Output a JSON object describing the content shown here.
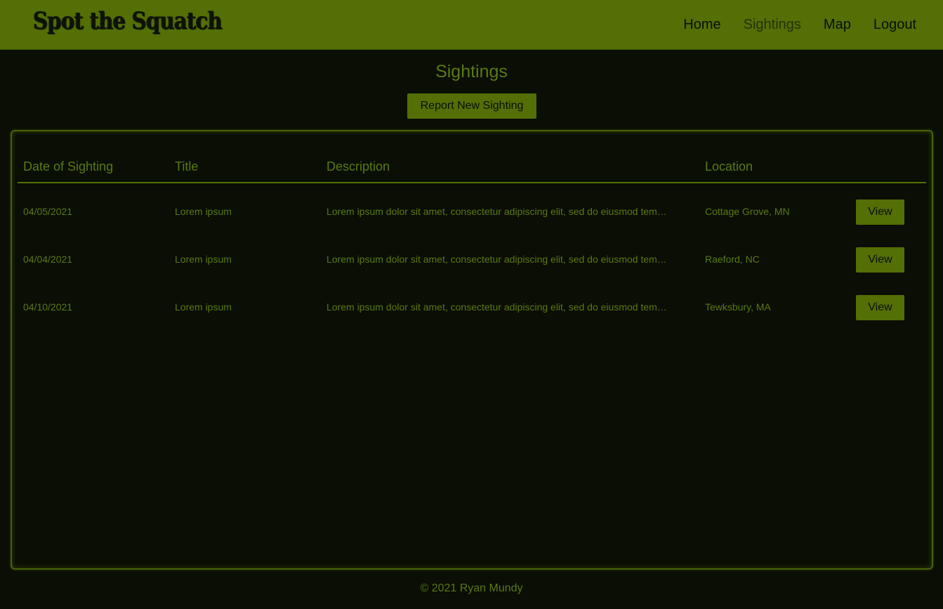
{
  "navbar": {
    "brand": "Spot the Squatch",
    "links": [
      {
        "label": "Home",
        "active": false
      },
      {
        "label": "Sightings",
        "active": true
      },
      {
        "label": "Map",
        "active": false
      },
      {
        "label": "Logout",
        "active": false
      }
    ]
  },
  "page": {
    "title": "Sightings",
    "report_button": "Report New Sighting"
  },
  "table": {
    "columns": [
      "Date of Sighting",
      "Title",
      "Description",
      "Location"
    ],
    "rows": [
      {
        "date": "04/05/2021",
        "title": "Lorem ipsum",
        "description": "Lorem ipsum dolor sit amet, consectetur adipiscing elit, sed do eiusmod tem…",
        "location": "Cottage Grove, MN",
        "action": "View"
      },
      {
        "date": "04/04/2021",
        "title": "Lorem ipsum",
        "description": "Lorem ipsum dolor sit amet, consectetur adipiscing elit, sed do eiusmod tem…",
        "location": "Raeford, NC",
        "action": "View"
      },
      {
        "date": "04/10/2021",
        "title": "Lorem ipsum",
        "description": "Lorem ipsum dolor sit amet, consectetur adipiscing elit, sed do eiusmod tem…",
        "location": "Tewksbury, MA",
        "action": "View"
      }
    ]
  },
  "footer": {
    "text": "© 2021 Ryan Mundy"
  },
  "colors": {
    "accent": "#536f05",
    "text_green": "#5a7a12",
    "background": "#0a0e04"
  }
}
